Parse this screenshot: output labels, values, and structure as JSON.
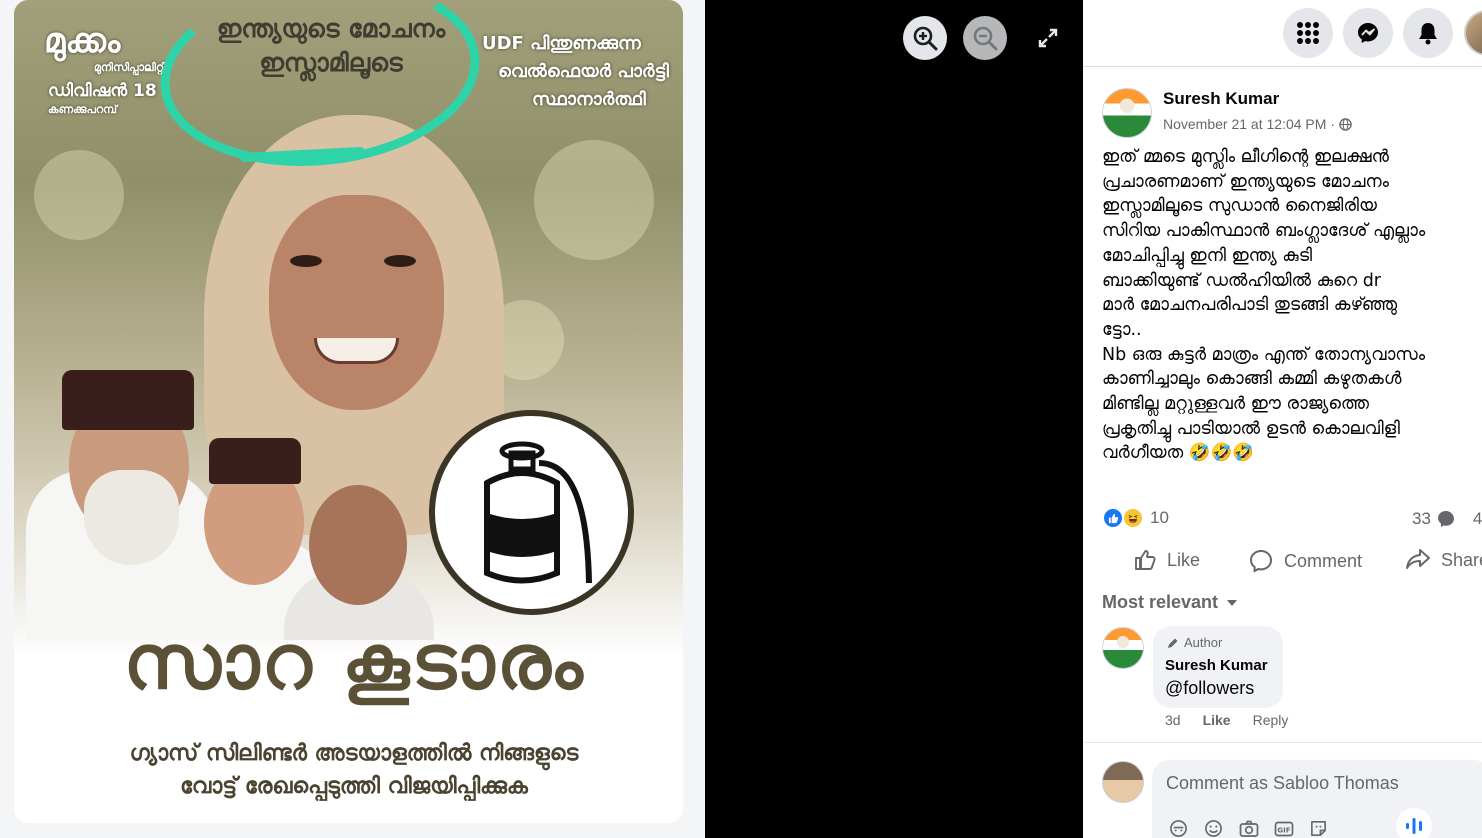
{
  "poster": {
    "slogan_line1": "ഇന്ത്യയുടെ മോചനം",
    "slogan_line2": "ഇസ്ലാമിലൂടെ",
    "municipality_line1": "മുക്കം",
    "municipality_line2": "മുനിസിപ്പാലിറ്റി",
    "division_line1": "ഡിവിഷൻ 18",
    "division_line2": "കണക്കുപറമ്പ്",
    "party_line1": "UDF പിന്തുണക്കുന്ന",
    "party_line2": "വെൽഫെയർ പാർട്ടി",
    "party_line3": "സ്ഥാനാർത്ഥി",
    "candidate_name": "സാറ കൂടാരം",
    "appeal_line1": "ഗ്യാസ് സിലിണ്ടർ അടയാളത്തിൽ നിങ്ങളുടെ",
    "appeal_line2": "വോട്ട് രേഖപ്പെടുത്തി വിജയിപ്പിക്കുക",
    "symbol": "gas-cylinder",
    "highlight_color": "#2fd3a8"
  },
  "viewer": {
    "zoom_in": "zoom-in-icon",
    "zoom_out": "zoom-out-icon",
    "fullscreen": "expand-icon"
  },
  "topbar": {
    "menu": "grid-menu-icon",
    "messenger": "messenger-icon",
    "notifications": "bell-icon"
  },
  "post": {
    "author": "Suresh Kumar",
    "timestamp": "November 21 at 12:04 PM",
    "separator": "·",
    "privacy": "globe-icon",
    "text": "ഇത് മ്മടെ മുസ്ലിം ലീഗിന്റെ ഇലക്ഷൻ\nപ്രചാരണമാണ് ഇന്ത്യയുടെ മോചനം\nഇസ്ലാമിലൂടെ സുഡാൻ നൈജിരിയ\nസിറിയ പാകിസ്ഥാൻ ബംഗ്ലാദേശ് എല്ലാം\nമോചിപ്പിച്ചു ഇനി ഇന്ത്യ കുടി\nബാക്കിയുണ്ട് ഡൽഹിയിൽ കുറെ dr\nമാർ മോചനപരിപാടി തുടങ്ങി കഴ്ഞ്ഞു\nട്ടോ..\nNb ഒരു കുട്ടർ മാത്രം എന്ത് തോന്യവാസം\nകാണിച്ചാലും കൊങ്ങി കമ്മി കഴുതകൾ\nമിണ്ടില്ല മറ്റുള്ളവർ ഈ രാജ്യത്തെ\nപ്രകൃതിച്ചു പാടിയാൽ ഉടൻ കൊലവിളി\nവർഗീയത 🤣🤣🤣",
    "reaction_count": "10",
    "comment_count": "33",
    "share_count": "4",
    "like_label": "Like",
    "comment_label": "Comment",
    "share_label": "Share"
  },
  "comments": {
    "sort_label": "Most relevant",
    "items": [
      {
        "badge": "Author",
        "name": "Suresh Kumar",
        "text": "@followers",
        "age": "3d",
        "like": "Like",
        "reply": "Reply"
      }
    ],
    "compose_placeholder": "Comment as Sabloo Thomas"
  },
  "colors": {
    "facebook_blue": "#1877f2",
    "secondary_text": "#65676b",
    "bubble_bg": "#f0f2f5"
  }
}
